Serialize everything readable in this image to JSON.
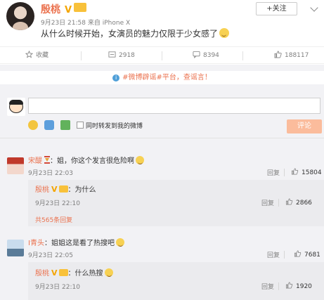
{
  "post": {
    "author": "殷桃",
    "verified_mark": "V",
    "vip_mark": "会员",
    "time": "9月23日 21:58",
    "source": "来自 iPhone X",
    "text": "从什么时候开始，女演员的魅力仅限于少女感了",
    "follow_label": "+关注"
  },
  "actions": {
    "favorite": "收藏",
    "repost": "2918",
    "comment": "8394",
    "like": "188117"
  },
  "notice": {
    "text": "#微博辟谣#平台，查谣言！"
  },
  "composer": {
    "input_value": "",
    "repost_checkbox_label": "同时转发到我的微博",
    "submit_label": "评论"
  },
  "comments": [
    {
      "name": "宋醍",
      "text": "：姐，你这个发言很危险啊",
      "time": "9月23日 22:03",
      "reply_label": "回复",
      "likes": "15804",
      "replies": [
        {
          "name": "殷桃",
          "text": "：为什么",
          "time": "9月23日 22:10",
          "reply_label": "回复",
          "likes": "2866"
        }
      ],
      "expand_label": "共565条回复"
    },
    {
      "name": "I青头",
      "text": "：姐姐这是看了热搜吧",
      "time": "9月23日 22:05",
      "reply_label": "回复",
      "likes": "7681",
      "replies": [
        {
          "name": "殷桃",
          "text": "：什么热搜",
          "time": "9月23日 22:10",
          "reply_label": "回复",
          "likes": "1920"
        }
      ]
    }
  ],
  "colors": {
    "accent": "#eb7350",
    "vip": "#f8c13a",
    "submit_disabled": "#fbbc9c",
    "panel": "#f2f2f5"
  },
  "icons": [
    "star-icon",
    "repost-icon",
    "comment-icon",
    "like-icon",
    "info-icon",
    "emoji-icon",
    "topic-icon",
    "image-icon",
    "chevron-down-icon"
  ]
}
